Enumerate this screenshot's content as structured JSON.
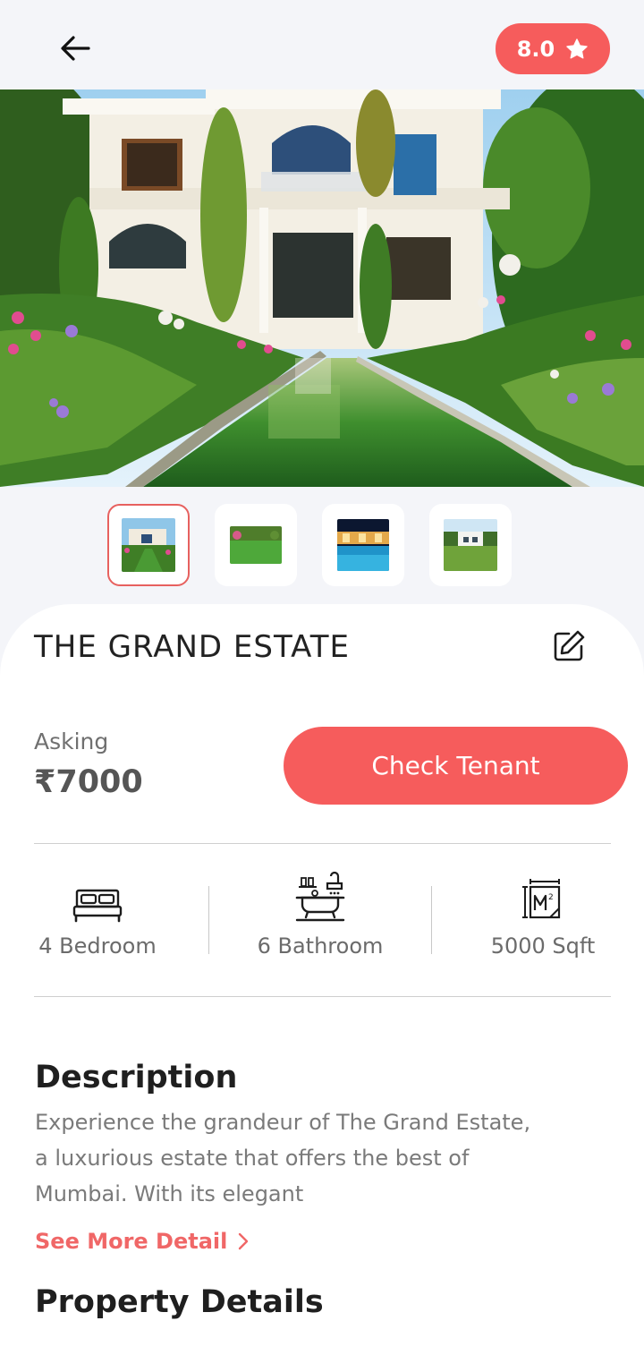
{
  "header": {
    "back_icon": "arrow-left-icon",
    "rating_value": "8.0",
    "rating_icon": "star-icon",
    "accent_color": "#f65c5c"
  },
  "gallery": {
    "main_image": "villa-garden-pool-photo",
    "thumbnails": [
      {
        "image": "villa-garden-pool-thumb",
        "active": true
      },
      {
        "image": "lawn-garden-thumb",
        "active": false
      },
      {
        "image": "night-pool-thumb",
        "active": false
      },
      {
        "image": "house-lawn-thumb",
        "active": false
      }
    ]
  },
  "property": {
    "title": "THE GRAND ESTATE",
    "edit_icon": "edit-icon",
    "asking_label": "Asking",
    "asking_price": "₹7000",
    "cta_label": "Check Tenant",
    "features": [
      {
        "icon": "bed-icon",
        "label": "4 Bedroom"
      },
      {
        "icon": "bathtub-icon",
        "label": "6 Bathroom"
      },
      {
        "icon": "area-icon",
        "label": "5000 Sqft"
      }
    ]
  },
  "description": {
    "heading": "Description",
    "text": "Experience the grandeur of The Grand Estate, a luxurious estate that offers the best of Mumbai. With its elegant",
    "see_more_label": "See More Detail",
    "see_more_icon": "chevron-right-icon"
  },
  "details": {
    "heading": "Property Details"
  }
}
